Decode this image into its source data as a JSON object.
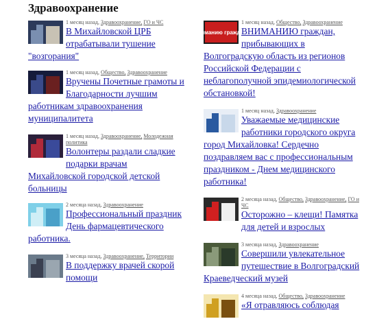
{
  "section_title": "Здравоохранение",
  "left": [
    {
      "thumb": {
        "icon": "fire-truck-photo",
        "colors": [
          "#2c3a5a",
          "#7a8fb0",
          "#c8c2b4"
        ]
      },
      "time": "1 месяц назад,",
      "tags": [
        "Здравоохранение,",
        "ГО и ЧС"
      ],
      "title": "В Михайловской ЦРБ отрабатывали тушение \"возгорания\""
    },
    {
      "thumb": {
        "icon": "award-ceremony-photo",
        "colors": [
          "#161b3a",
          "#3a4a8a",
          "#6a2020"
        ]
      },
      "time": "1 месяц назад,",
      "tags": [
        "Общество,",
        "Здравоохранение"
      ],
      "title": "Вручены Почетные грамоты и Благодарности лучшим работникам здравоохранения муниципалитета"
    },
    {
      "thumb": {
        "icon": "volunteers-photo",
        "colors": [
          "#2a1f3a",
          "#b02a3a",
          "#3a4a9a"
        ]
      },
      "time": "1 месяц назад,",
      "tags": [
        "Здравоохранение,",
        "Молодежная политика"
      ],
      "title": "Волонтеры раздали сладкие подарки врачам Михайловской городской детской больницы"
    },
    {
      "thumb": {
        "icon": "pharmacy-card-image",
        "colors": [
          "#7fd0e8",
          "#cfeef6",
          "#4aa0c8"
        ]
      },
      "time": "2 месяца назад,",
      "tags": [
        "Здравоохранение"
      ],
      "title": "Профессиональный праздник День фармацевтического работника."
    },
    {
      "thumb": {
        "icon": "city-street-photo",
        "colors": [
          "#6a7a8a",
          "#3a4050",
          "#9aa6b0"
        ]
      },
      "time": "3 месяца назад,",
      "tags": [
        "Здравоохранение,",
        "Территории"
      ],
      "title": "В поддержку врачей скорой помощи"
    }
  ],
  "right": [
    {
      "thumb": {
        "icon": "warning-sign-image",
        "colors": [
          "#1b1b1b",
          "#c81e1e",
          "#ffffff"
        ],
        "text": "Вниманию граждан!"
      },
      "time": "1 месяц назад,",
      "tags": [
        "Общество,",
        "Здравоохранение"
      ],
      "title": "ВНИМАНИЮ граждан, прибывающих в Волгоградскую область из регионов Российской Федерации с неблагополучной эпидемиологической обстановкой!"
    },
    {
      "thumb": {
        "icon": "medical-greeting-image",
        "colors": [
          "#e8eef6",
          "#2a5aa0",
          "#c8d8ea"
        ]
      },
      "time": "1 месяц назад,",
      "tags": [
        "Здравоохранение"
      ],
      "title": "Уважаемые медицинские работники городского округа город Михайловка! Сердечно поздравляем вас с профессиональным праздником - Днем медицинского работника!"
    },
    {
      "thumb": {
        "icon": "tick-warning-image",
        "colors": [
          "#2a2a2a",
          "#d02020",
          "#f0f0f0"
        ]
      },
      "time": "2 месяца назад,",
      "tags": [
        "Общество,",
        "Здравоохранение,",
        "ГО и ЧС"
      ],
      "title": "Осторожно – клещи! Памятка для детей и взрослых"
    },
    {
      "thumb": {
        "icon": "museum-trip-photo",
        "colors": [
          "#4a5a3a",
          "#8a9a7a",
          "#2a3a2a"
        ]
      },
      "time": "3 месяца назад,",
      "tags": [
        "Здравоохранение"
      ],
      "title": "Совершили увлекательное путешествие в Волгоградский Краеведческий музей"
    },
    {
      "thumb": {
        "icon": "rules-notice-image",
        "colors": [
          "#f4e6b0",
          "#d0a020",
          "#7a5010"
        ]
      },
      "time": "4 месяца назад,",
      "tags": [
        "Общество,",
        "Здравоохранение"
      ],
      "title": "«Я отравляюсь соблюдая"
    }
  ]
}
